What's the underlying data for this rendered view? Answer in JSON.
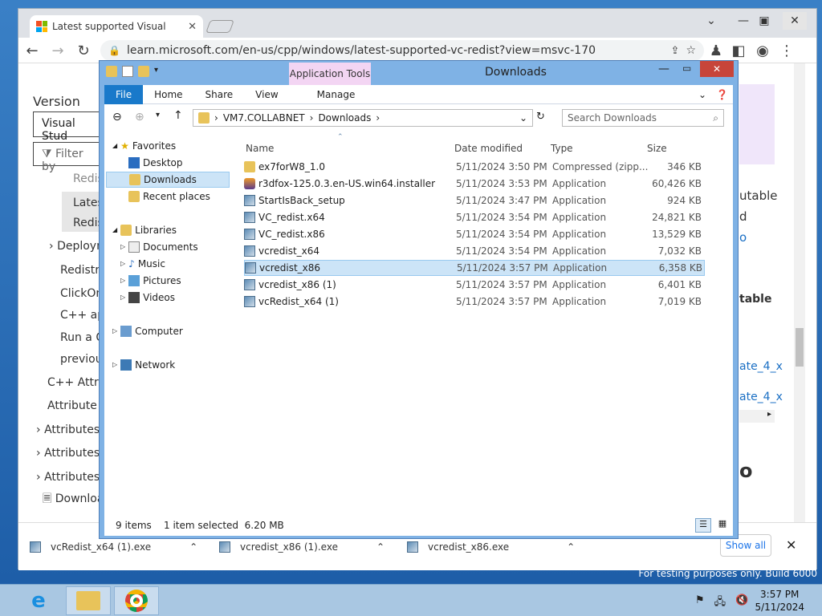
{
  "desktop": {
    "watermark": "For testing purposes only. Build 6000"
  },
  "browser": {
    "tab_title": "Latest supported Visual",
    "url": "learn.microsoft.com/en-us/cpp/windows/latest-supported-vc-redist?view=msvc-170",
    "page_left": {
      "heading": "Version",
      "version_select": "Visual Stud",
      "filter_placeholder": "Filter by",
      "items": [
        "Redis",
        "Lates",
        "Redis",
        "Deploym",
        "Redistril",
        "ClickOn",
        "C++ ap",
        "Run a C",
        "previou",
        "C++ Attrib",
        "Attribute p",
        "Attributes",
        "Attributes",
        "Attributes",
        "Downloa"
      ]
    },
    "page_right": [
      "utable",
      "d",
      "o",
      "table",
      "ate_4_x",
      "ate_4_x",
      "o"
    ],
    "downloads": [
      {
        "name": "vcRedist_x64 (1).exe"
      },
      {
        "name": "vcredist_x86 (1).exe"
      },
      {
        "name": "vcredist_x86.exe"
      }
    ],
    "show_all": "Show all"
  },
  "explorer": {
    "title": "Downloads",
    "app_tools": "Application Tools",
    "ribbon_tabs": [
      "File",
      "Home",
      "Share",
      "View",
      "Manage"
    ],
    "path": [
      "VM7.COLLABNET",
      "Downloads"
    ],
    "search_placeholder": "Search Downloads",
    "nav": {
      "favorites": "Favorites",
      "desktop": "Desktop",
      "downloads": "Downloads",
      "recent": "Recent places",
      "libraries": "Libraries",
      "documents": "Documents",
      "music": "Music",
      "pictures": "Pictures",
      "videos": "Videos",
      "computer": "Computer",
      "network": "Network"
    },
    "columns": {
      "name": "Name",
      "date": "Date modified",
      "type": "Type",
      "size": "Size"
    },
    "files": [
      {
        "name": "ex7forW8_1.0",
        "date": "5/11/2024 3:50 PM",
        "type": "Compressed (zipp...",
        "size": "346 KB",
        "icon": "zip-folder-icon"
      },
      {
        "name": "r3dfox-125.0.3.en-US.win64.installer",
        "date": "5/11/2024 3:53 PM",
        "type": "Application",
        "size": "60,426 KB",
        "icon": "firefox-icon"
      },
      {
        "name": "StartIsBack_setup",
        "date": "5/11/2024 3:47 PM",
        "type": "Application",
        "size": "924 KB",
        "icon": "installer-icon"
      },
      {
        "name": "VC_redist.x64",
        "date": "5/11/2024 3:54 PM",
        "type": "Application",
        "size": "24,821 KB",
        "icon": "installer-icon"
      },
      {
        "name": "VC_redist.x86",
        "date": "5/11/2024 3:54 PM",
        "type": "Application",
        "size": "13,529 KB",
        "icon": "installer-icon"
      },
      {
        "name": "vcredist_x64",
        "date": "5/11/2024 3:54 PM",
        "type": "Application",
        "size": "7,032 KB",
        "icon": "installer-icon"
      },
      {
        "name": "vcredist_x86",
        "date": "5/11/2024 3:57 PM",
        "type": "Application",
        "size": "6,358 KB",
        "icon": "installer-icon"
      },
      {
        "name": "vcredist_x86 (1)",
        "date": "5/11/2024 3:57 PM",
        "type": "Application",
        "size": "6,401 KB",
        "icon": "installer-icon"
      },
      {
        "name": "vcRedist_x64 (1)",
        "date": "5/11/2024 3:57 PM",
        "type": "Application",
        "size": "7,019 KB",
        "icon": "installer-icon"
      }
    ],
    "status": {
      "count": "9 items",
      "selection": "1 item selected  6.20 MB"
    }
  },
  "taskbar": {
    "time": "3:57 PM",
    "date": "5/11/2024"
  }
}
